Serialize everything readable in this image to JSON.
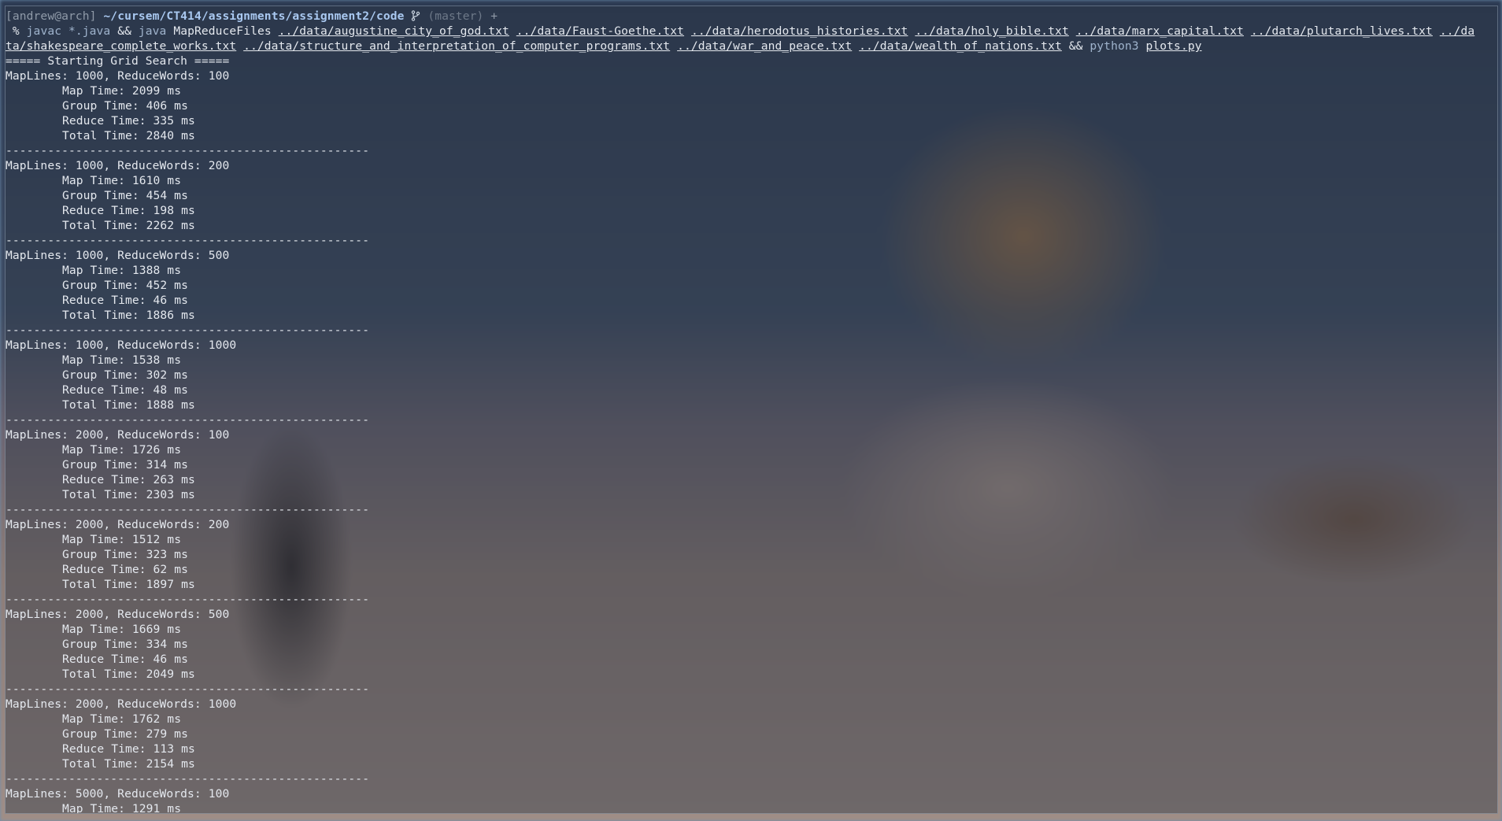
{
  "prompt": {
    "user_host": "[andrew@arch]",
    "path": "~/cursem/CT414/assignments/assignment2/code",
    "branch_icon": "git-branch-icon",
    "branch": "(master)",
    "plus": "+",
    "symbol": "%",
    "cmd1": "javac",
    "cmd1_arg": "*.java",
    "op": "&&",
    "cmd2": "java",
    "cmd2_arg": "MapReduceFiles",
    "files_line1": [
      "../data/augustine_city_of_god.txt",
      "../data/Faust-Goethe.txt",
      "../data/herodotus_histories.txt",
      "../data/holy_bible.txt",
      "../data/marx_capital.txt",
      "../data/plutarch_lives.txt"
    ],
    "file_wrap_start": "../da",
    "file_wrap_end": "ta/shakespeare_complete_works.txt",
    "files_line2": [
      "../data/structure_and_interpretation_of_computer_programs.txt",
      "../data/war_and_peace.txt",
      "../data/wealth_of_nations.txt"
    ],
    "op2": "&&",
    "cmd3": "python3",
    "cmd3_arg": "plots.py"
  },
  "banner": "===== Starting Grid Search =====",
  "separator": "----------------------------------------------------",
  "labels": {
    "map": "Map Time:",
    "group": "Group Time:",
    "reduce": "Reduce Time:",
    "total": "Total Time:"
  },
  "runs": [
    {
      "header": "MapLines: 1000, ReduceWords: 100",
      "map": "2099 ms",
      "group": "406 ms",
      "reduce": "335 ms",
      "total": "2840 ms"
    },
    {
      "header": "MapLines: 1000, ReduceWords: 200",
      "map": "1610 ms",
      "group": "454 ms",
      "reduce": "198 ms",
      "total": "2262 ms"
    },
    {
      "header": "MapLines: 1000, ReduceWords: 500",
      "map": "1388 ms",
      "group": "452 ms",
      "reduce": "46 ms",
      "total": "1886 ms"
    },
    {
      "header": "MapLines: 1000, ReduceWords: 1000",
      "map": "1538 ms",
      "group": "302 ms",
      "reduce": "48 ms",
      "total": "1888 ms"
    },
    {
      "header": "MapLines: 2000, ReduceWords: 100",
      "map": "1726 ms",
      "group": "314 ms",
      "reduce": "263 ms",
      "total": "2303 ms"
    },
    {
      "header": "MapLines: 2000, ReduceWords: 200",
      "map": "1512 ms",
      "group": "323 ms",
      "reduce": "62 ms",
      "total": "1897 ms"
    },
    {
      "header": "MapLines: 2000, ReduceWords: 500",
      "map": "1669 ms",
      "group": "334 ms",
      "reduce": "46 ms",
      "total": "2049 ms"
    },
    {
      "header": "MapLines: 2000, ReduceWords: 1000",
      "map": "1762 ms",
      "group": "279 ms",
      "reduce": "113 ms",
      "total": "2154 ms"
    }
  ],
  "last_run": {
    "header": "MapLines: 5000, ReduceWords: 100",
    "map": "1291 ms"
  }
}
